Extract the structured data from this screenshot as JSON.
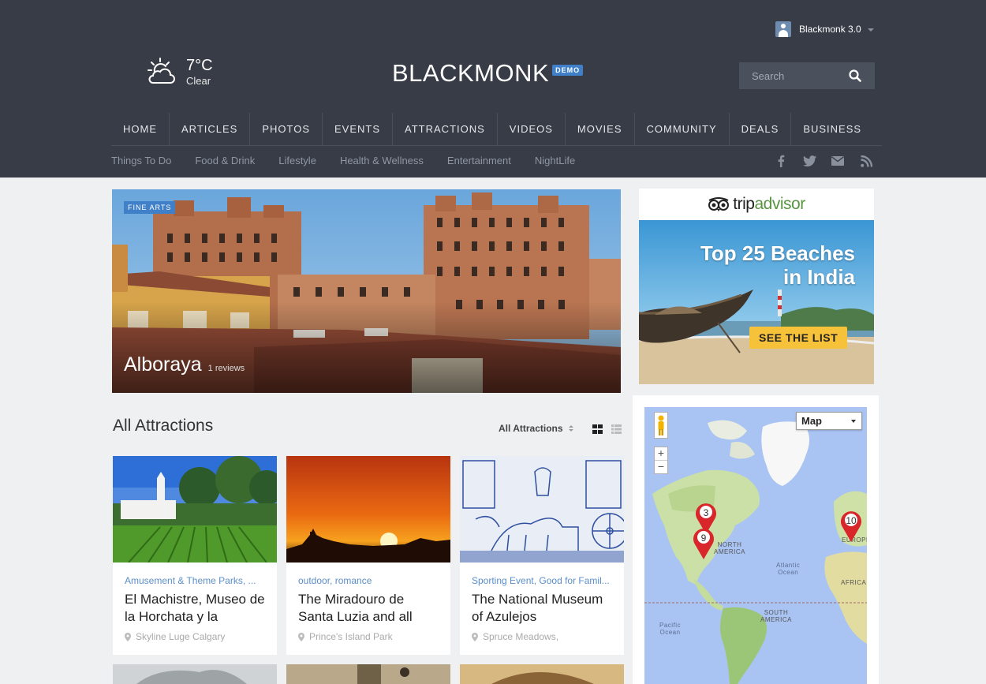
{
  "header": {
    "user": {
      "name": "Blackmonk 3.0"
    },
    "weather": {
      "temperature": "7°C",
      "condition": "Clear",
      "icon": "partly-cloudy-icon"
    },
    "logo": {
      "text": "BLACKMONK",
      "badge": "DEMO"
    },
    "search": {
      "placeholder": "Search"
    },
    "main_nav": [
      "HOME",
      "ARTICLES",
      "PHOTOS",
      "EVENTS",
      "ATTRACTIONS",
      "VIDEOS",
      "MOVIES",
      "COMMUNITY",
      "DEALS",
      "BUSINESS"
    ],
    "sub_nav": [
      "Things To Do",
      "Food & Drink",
      "Lifestyle",
      "Health & Wellness",
      "Entertainment",
      "NightLife"
    ],
    "social": [
      "facebook-icon",
      "twitter-icon",
      "email-icon",
      "rss-icon"
    ]
  },
  "hero": {
    "tag": "FINE ARTS",
    "title": "Alboraya",
    "reviews": "1 reviews"
  },
  "ad": {
    "brand_prefix": "trip",
    "brand_suffix": "advisor",
    "headline_line1": "Top 25 Beaches",
    "headline_line2": "in India",
    "cta": "SEE THE LIST"
  },
  "section": {
    "title": "All Attractions",
    "sort_label": "All Attractions"
  },
  "cards": [
    {
      "categories": "Amusement & Theme Parks, ...",
      "title": "El Machistre, Museo de la Horchata y la",
      "location": "Skyline Luge Calgary"
    },
    {
      "categories": "outdoor, romance",
      "title": "The Miradouro de Santa Luzia and all",
      "location": "Prince's Island Park"
    },
    {
      "categories": "Sporting Event, Good for Famil...",
      "title": "The National Museum of Azulejos",
      "location": "Spruce Meadows,"
    }
  ],
  "map": {
    "type_select": "Map",
    "zoom_in": "+",
    "zoom_out": "−",
    "markers": [
      "3",
      "9",
      "10"
    ],
    "labels": {
      "north_america_1": "NORTH",
      "north_america_2": "AMERICA",
      "atlantic_1": "Atlantic",
      "atlantic_2": "Ocean",
      "africa": "AFRICA",
      "europe": "EUROPE",
      "south_america_1": "SOUTH",
      "south_america_2": "AMERICA",
      "pacific_1": "Pacific",
      "pacific_2": "Ocean"
    }
  },
  "colors": {
    "header_bg": "#373c47",
    "accent": "#3f80c8",
    "category_link": "#5b8fc9",
    "marker": "#d9262b"
  }
}
